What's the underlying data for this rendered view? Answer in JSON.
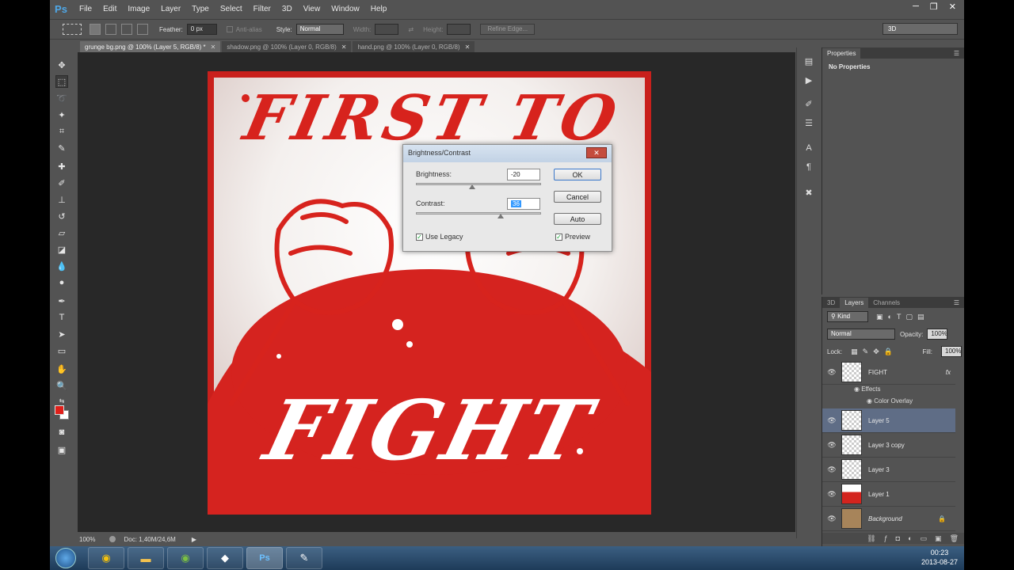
{
  "app": {
    "logo": "Ps"
  },
  "menu": [
    "File",
    "Edit",
    "Image",
    "Layer",
    "Type",
    "Select",
    "Filter",
    "3D",
    "View",
    "Window",
    "Help"
  ],
  "window_controls": [
    "─",
    "❐",
    "✕"
  ],
  "options": {
    "feather_label": "Feather:",
    "feather_value": "0 px",
    "antialias_label": "Anti-alias",
    "style_label": "Style:",
    "style_value": "Normal",
    "width_label": "Width:",
    "height_label": "Height:",
    "refine_edge": "Refine Edge...",
    "workspace": "3D"
  },
  "tabs": [
    {
      "label": "grunge bg.png @ 100% (Layer 5, RGB/8) *",
      "active": true
    },
    {
      "label": "shadow.png @ 100% (Layer 0, RGB/8)",
      "active": false
    },
    {
      "label": "hand.png @ 100% (Layer 0, RGB/8)",
      "active": false
    }
  ],
  "artwork": {
    "top_text": "FIRST TO",
    "bottom_text": "FIGHT"
  },
  "status": {
    "zoom": "100%",
    "doc": "Doc: 1,40M/24,6M"
  },
  "dialog": {
    "title": "Brightness/Contrast",
    "brightness_label": "Brightness:",
    "brightness_value": "-20",
    "brightness_pos": 0.45,
    "contrast_label": "Contrast:",
    "contrast_value": "36",
    "contrast_pos": 0.68,
    "ok": "OK",
    "cancel": "Cancel",
    "auto": "Auto",
    "use_legacy": "Use Legacy",
    "preview": "Preview"
  },
  "properties": {
    "title": "Properties",
    "content": "No Properties"
  },
  "layers_panel": {
    "tabs": [
      "3D",
      "Layers",
      "Channels"
    ],
    "filter": "Kind",
    "blend_mode": "Normal",
    "opacity_label": "Opacity:",
    "opacity_value": "100%",
    "lock_label": "Lock:",
    "fill_label": "Fill:",
    "fill_value": "100%",
    "layers": [
      {
        "name": "FIGHT",
        "fx": "fx",
        "thumb": "transparent",
        "selected": false
      },
      {
        "name": "Layer 5",
        "thumb": "transparent",
        "selected": true
      },
      {
        "name": "Layer 3 copy",
        "thumb": "transparent",
        "selected": false
      },
      {
        "name": "Layer 3",
        "thumb": "transparent",
        "selected": false
      },
      {
        "name": "Layer 1",
        "thumb": "red",
        "selected": false
      },
      {
        "name": "Background",
        "thumb": "bg",
        "selected": false
      }
    ],
    "effects_label": "Effects",
    "color_overlay": "Color Overlay"
  },
  "taskbar": {
    "time": "00:23",
    "date": "2013-08-27"
  },
  "colors": {
    "accent": "#d5231f",
    "ui_bg": "#535353",
    "canvas_bg": "#282828"
  }
}
